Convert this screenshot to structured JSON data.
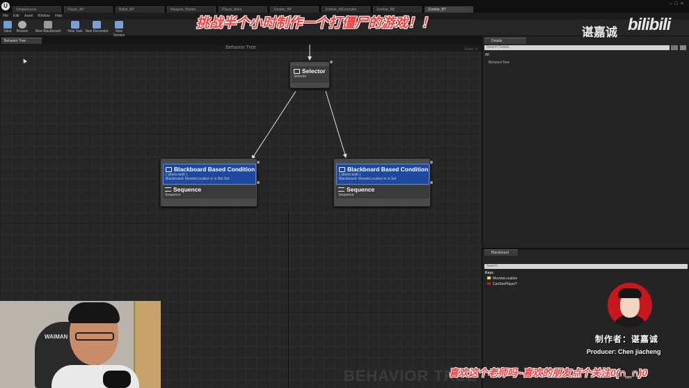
{
  "window": {
    "tabs": [
      {
        "label": "SimpleScene",
        "active": false
      },
      {
        "label": "Player_BP",
        "active": false
      },
      {
        "label": "Bullet_BP",
        "active": false
      },
      {
        "label": "Weapon_Master",
        "active": false
      },
      {
        "label": "Player_Anim",
        "active": false
      },
      {
        "label": "Zombie_BP",
        "active": false
      },
      {
        "label": "Zombie_AIController",
        "active": false
      },
      {
        "label": "Zombie_BB",
        "active": false
      },
      {
        "label": "Zombie_BT",
        "active": true
      }
    ]
  },
  "menu": [
    "File",
    "Edit",
    "Asset",
    "Window",
    "Help"
  ],
  "toolbar": {
    "buttons": [
      {
        "label": "Save",
        "icon": "save-icon",
        "color": "#6f9fd8"
      },
      {
        "label": "Browse",
        "icon": "browse-icon",
        "color": "#b0b0b0"
      },
      {
        "label": "New Blackboard",
        "icon": "blackboard-icon",
        "color": "#9a9a9a"
      },
      {
        "label": "New Task",
        "icon": "task-icon",
        "color": "#7aa0d8"
      },
      {
        "label": "New Decorator",
        "icon": "decorator-icon",
        "color": "#7aa0d8"
      },
      {
        "label": "New Service",
        "icon": "service-icon",
        "color": "#7aa0d8"
      }
    ]
  },
  "panel_tab": "Behavior Tree",
  "graph": {
    "header": "Behavior Tree",
    "zoom": "Zoom -4",
    "watermark": "BEHAVIOR TREE"
  },
  "nodes": {
    "selector": {
      "title": "Selector",
      "subtitle": "Selector"
    },
    "left": {
      "decorator_title": "Blackboard Based Condition",
      "aborts": "( aborts both )",
      "condition": "Blackboard: MovetoLocation is Is Not Set",
      "composite_title": "Sequence",
      "composite_sub": "Sequence"
    },
    "right": {
      "decorator_title": "Blackboard Based Condition",
      "aborts": "( aborts both )",
      "condition": "Blackboard: MovetoLocation is Is Set",
      "composite_title": "Sequence",
      "composite_sub": "Sequence"
    }
  },
  "details": {
    "tab": "Details",
    "search_placeholder": "Search Details",
    "filter": "All",
    "item": "BehaviorTree"
  },
  "blackboard": {
    "tab": "Blackboard",
    "search_placeholder": "Search",
    "section": "Keys",
    "keys": [
      {
        "name": "MovetoLocation",
        "color": "#e8e832"
      },
      {
        "name": "CanSeePlayer?",
        "color": "#b02020"
      }
    ]
  },
  "overlay": {
    "title": "挑战半个小时制作一个打僵尸的游戏！！",
    "brand": "谌嘉诚",
    "bili_logo": "bilibili",
    "producer_cn": "制作者：谌嘉诚",
    "producer_en": "Producer: Chen jiacheng",
    "bottom_message": "喜欢这个老师吗~喜欢的朋友点个关注0(∩_∩)0",
    "webcam_chair_text": "WAIMAN"
  }
}
